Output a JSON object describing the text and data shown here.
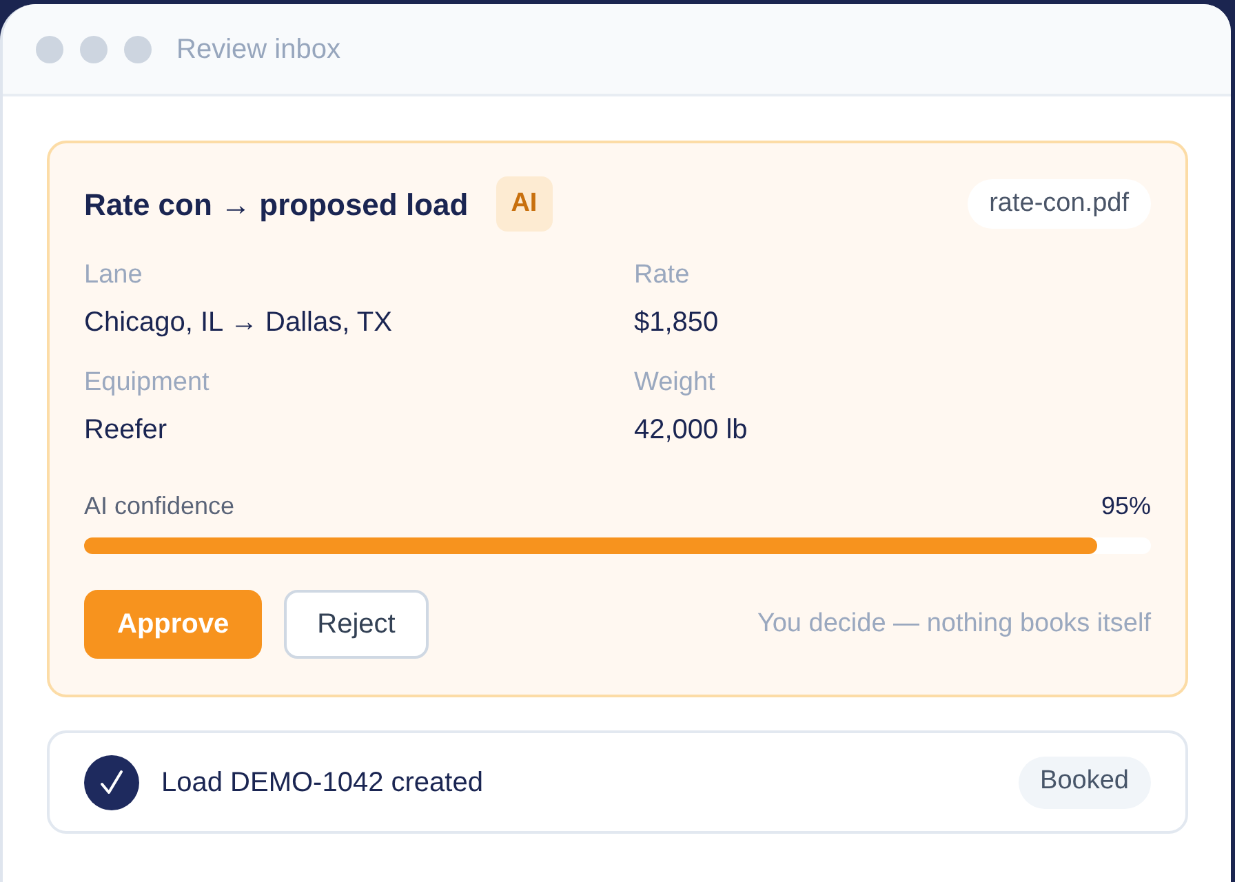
{
  "window": {
    "title": "Review inbox"
  },
  "proposal": {
    "title": "Rate con → proposed load",
    "badge": "AI",
    "attachment": "rate-con.pdf",
    "fields": [
      {
        "label": "Lane",
        "value": "Chicago, IL → Dallas, TX"
      },
      {
        "label": "Rate",
        "value": "$1,850"
      },
      {
        "label": "Equipment",
        "value": "Reefer"
      },
      {
        "label": "Weight",
        "value": "42,000 lb"
      }
    ],
    "confidence": {
      "label": "AI confidence",
      "reading": "95%",
      "level": 0.95
    },
    "actions": [
      {
        "label": "Approve",
        "kind": "primary"
      },
      {
        "label": "Reject",
        "kind": "secondary"
      }
    ],
    "note": "You decide — nothing books itself"
  },
  "result": {
    "message": "Load DEMO-1042 created",
    "status": "Booked"
  }
}
